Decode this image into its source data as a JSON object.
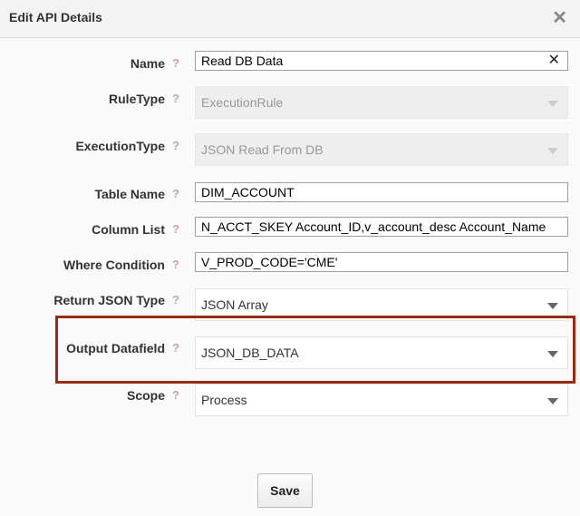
{
  "dialog": {
    "title": "Edit API Details",
    "close_glyph": "✕",
    "help_glyph": "?",
    "clear_glyph": "✕"
  },
  "fields": {
    "name": {
      "label": "Name",
      "value": "Read DB Data"
    },
    "rule_type": {
      "label": "RuleType",
      "value": "ExecutionRule"
    },
    "execution_type": {
      "label": "ExecutionType",
      "value": "JSON Read From DB"
    },
    "table_name": {
      "label": "Table Name",
      "value": "DIM_ACCOUNT"
    },
    "column_list": {
      "label": "Column List",
      "value": "N_ACCT_SKEY Account_ID,v_account_desc Account_Name"
    },
    "where_condition": {
      "label": "Where Condition",
      "value": "V_PROD_CODE='CME'"
    },
    "return_json_type": {
      "label": "Return JSON Type",
      "value": "JSON Array"
    },
    "output_datafield": {
      "label": "Output Datafield",
      "value": "JSON_DB_DATA"
    },
    "scope": {
      "label": "Scope",
      "value": "Process"
    }
  },
  "buttons": {
    "save": "Save"
  },
  "colors": {
    "highlight_border": "#9a2a14"
  }
}
